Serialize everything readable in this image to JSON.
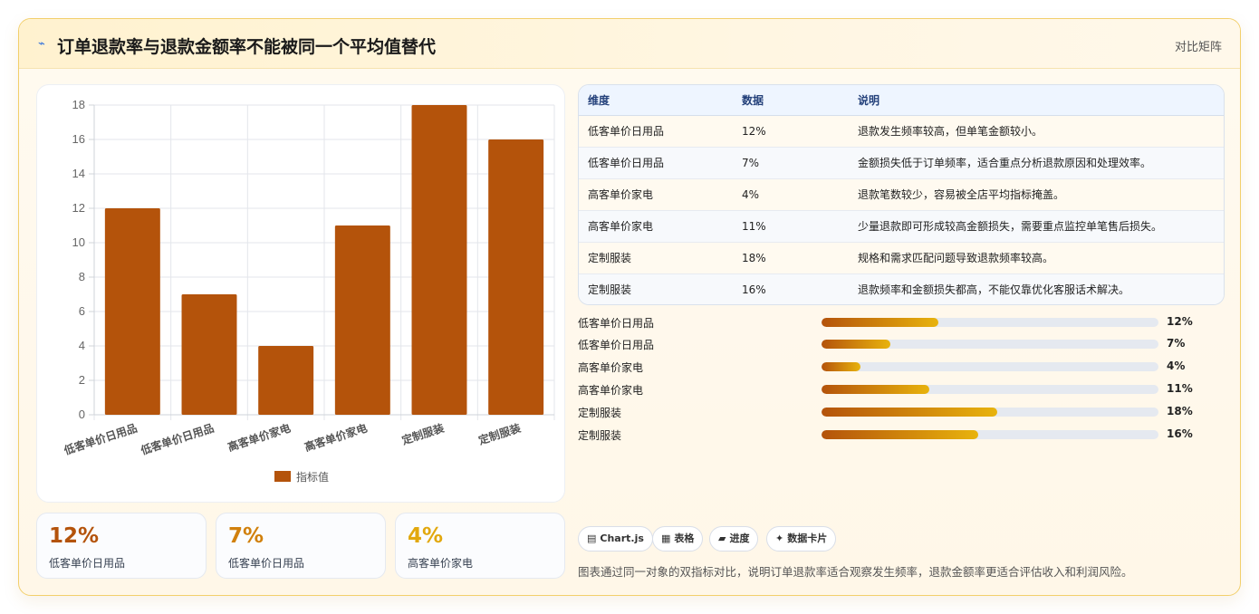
{
  "header": {
    "icon": "lightning-icon",
    "title": "订单退款率与退款金额率不能被同一个平均值替代",
    "tag": "对比矩阵"
  },
  "chart_data": {
    "type": "bar",
    "categories": [
      "低客单价日用品",
      "低客单价日用品",
      "高客单价家电",
      "高客单价家电",
      "定制服装",
      "定制服装"
    ],
    "series": [
      {
        "name": "指标值",
        "values": [
          12,
          7,
          4,
          11,
          18,
          16
        ],
        "color": "#b4530b"
      }
    ],
    "ylim": [
      0,
      18
    ],
    "yticks": [
      0,
      2,
      4,
      6,
      8,
      10,
      12,
      14,
      16,
      18
    ],
    "grid": true,
    "legend": "bottom"
  },
  "stats": [
    {
      "value": "12%",
      "label": "低客单价日用品",
      "color": "#b4530b"
    },
    {
      "value": "7%",
      "label": "低客单价日用品",
      "color": "#d1800c"
    },
    {
      "value": "4%",
      "label": "高客单价家电",
      "color": "#e2a80e"
    }
  ],
  "table": {
    "headers": [
      "维度",
      "数据",
      "说明"
    ],
    "rows": [
      [
        "低客单价日用品",
        "12%",
        "退款发生频率较高，但单笔金额较小。"
      ],
      [
        "低客单价日用品",
        "7%",
        "金额损失低于订单频率，适合重点分析退款原因和处理效率。"
      ],
      [
        "高客单价家电",
        "4%",
        "退款笔数较少，容易被全店平均指标掩盖。"
      ],
      [
        "高客单价家电",
        "11%",
        "少量退款即可形成较高金额损失，需要重点监控单笔售后损失。"
      ],
      [
        "定制服装",
        "18%",
        "规格和需求匹配问题导致退款频率较高。"
      ],
      [
        "定制服装",
        "16%",
        "退款频率和金额损失都高，不能仅靠优化客服话术解决。"
      ]
    ]
  },
  "progress": [
    {
      "label": "低客单价日用品",
      "value": "12%",
      "fraction": 0.12
    },
    {
      "label": "低客单价日用品",
      "value": "7%",
      "fraction": 0.07
    },
    {
      "label": "高客单价家电",
      "value": "4%",
      "fraction": 0.04
    },
    {
      "label": "高客单价家电",
      "value": "11%",
      "fraction": 0.11
    },
    {
      "label": "定制服装",
      "value": "18%",
      "fraction": 0.18
    },
    {
      "label": "定制服装",
      "value": "16%",
      "fraction": 0.16
    }
  ],
  "chips": [
    {
      "icon": "chart-icon",
      "glyph": "▤",
      "label": "Chart.js"
    },
    {
      "icon": "table-icon",
      "glyph": "▦",
      "label": "表格"
    },
    {
      "icon": "progress-icon",
      "glyph": "▰",
      "label": "进度"
    },
    {
      "icon": "sparkle-icon",
      "glyph": "✦",
      "label": "数据卡片"
    }
  ],
  "footnote": "图表通过同一对象的双指标对比，说明订单退款率适合观察发生频率，退款金额率更适合评估收入和利润风险。"
}
